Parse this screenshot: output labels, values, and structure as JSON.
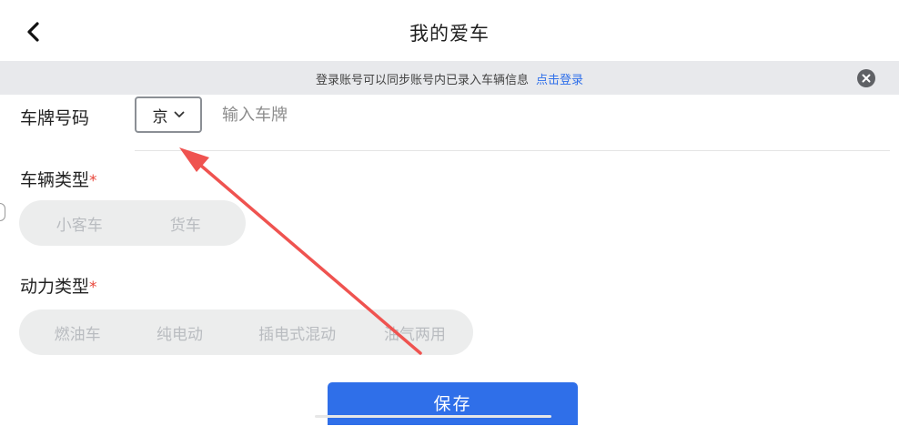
{
  "header": {
    "title": "我的爱车",
    "back_icon": "chevron-left-icon"
  },
  "banner": {
    "text": "登录账号可以同步账号内已录入车辆信息",
    "link": "点击登录",
    "close_icon": "close-circle-icon"
  },
  "plate": {
    "label": "车牌号码",
    "province": "京",
    "dropdown_icon": "chevron-down-icon",
    "input_placeholder": "输入车牌",
    "input_value": ""
  },
  "vehicle_type": {
    "label": "车辆类型",
    "required_mark": "*",
    "options": [
      "小客车",
      "货车"
    ]
  },
  "power_type": {
    "label": "动力类型",
    "required_mark": "*",
    "options": [
      "燃油车",
      "纯电动",
      "插电式混动",
      "油气两用"
    ]
  },
  "actions": {
    "save_label": "保存"
  },
  "colors": {
    "accent": "#2f6fe9",
    "required": "#e8463a",
    "annotation_arrow": "#ef5350",
    "banner_bg": "#e8e9ec"
  }
}
